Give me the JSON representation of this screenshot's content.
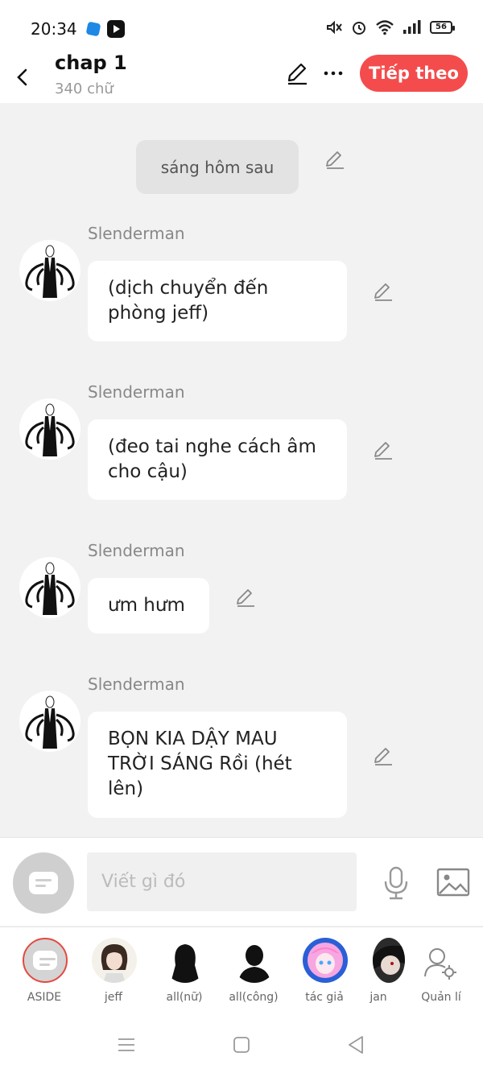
{
  "status_bar": {
    "time": "20:34",
    "battery": "56"
  },
  "header": {
    "title": "chap 1",
    "word_count": "340 chữ",
    "next_label": "Tiếp theo"
  },
  "chat": {
    "narration": "sáng hôm sau",
    "messages": [
      {
        "sender": "Slenderman",
        "text": "(dịch chuyển đến phòng jeff)"
      },
      {
        "sender": "Slenderman",
        "text": "(đeo tai nghe cách âm cho cậu)"
      },
      {
        "sender": "Slenderman",
        "text": "ưm hưm"
      },
      {
        "sender": "Slenderman",
        "text": "BỌN KIA DẬY MAU TRỜI SÁNG Rồi (hét lên)"
      }
    ]
  },
  "input": {
    "placeholder": "Viết gì đó"
  },
  "characters": [
    {
      "label": "ASIDE"
    },
    {
      "label": "jeff"
    },
    {
      "label": "all(nữ)"
    },
    {
      "label": "all(công)"
    },
    {
      "label": "tác giả"
    },
    {
      "label": "jan"
    },
    {
      "label": "Quản lí"
    }
  ],
  "colors": {
    "accent": "#f44c4c",
    "background": "#f2f2f2",
    "bubble": "#ffffff"
  }
}
